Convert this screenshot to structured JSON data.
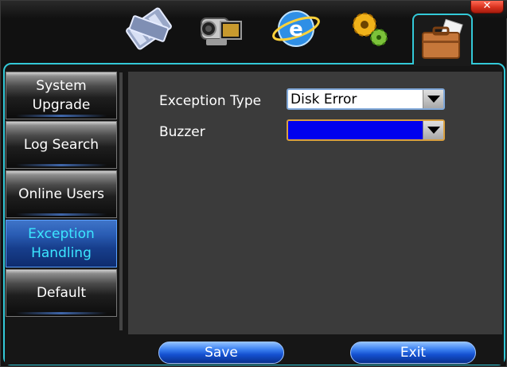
{
  "window": {
    "close_symbol": "✕"
  },
  "tabs": [
    {
      "icon": "video-film-icon"
    },
    {
      "icon": "camcorder-icon"
    },
    {
      "icon": "network-globe-icon"
    },
    {
      "icon": "gears-settings-icon"
    },
    {
      "icon": "briefcase-tools-icon",
      "active": true
    }
  ],
  "sidebar": {
    "items": [
      {
        "label_line1": "System",
        "label_line2": "Upgrade"
      },
      {
        "label_line1": "Log Search",
        "label_line2": ""
      },
      {
        "label_line1": "Online Users",
        "label_line2": ""
      },
      {
        "label_line1": "Exception",
        "label_line2": "Handling",
        "active": true
      },
      {
        "label_line1": "Default",
        "label_line2": ""
      }
    ]
  },
  "form": {
    "exception_type_label": "Exception Type",
    "exception_type_value": "Disk Error",
    "buzzer_label": "Buzzer",
    "buzzer_value": ""
  },
  "footer": {
    "save_label": "Save",
    "exit_label": "Exit"
  },
  "colors": {
    "accent": "#33c9d8",
    "active_menu_text": "#3ce6ff",
    "buzzer_fill": "#0000ee"
  }
}
